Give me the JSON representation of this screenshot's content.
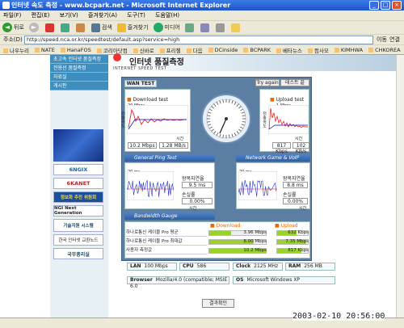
{
  "window": {
    "title": "인터넷 속도 측정 - www.bcpark.net - Microsoft Internet Explorer"
  },
  "menu": [
    "파일(F)",
    "편집(E)",
    "보기(V)",
    "즐겨찾기(A)",
    "도구(T)",
    "도움말(H)"
  ],
  "toolbar": {
    "back": "뒤로",
    "search": "검색",
    "favorites": "즐겨찾기",
    "media": "미디어"
  },
  "address": {
    "label": "주소(D)",
    "url": "http://speed.nca.or.kr/speedtest/default.asp?service=high",
    "go": "이동",
    "links": "연결"
  },
  "links": [
    "나우누리",
    "NATE",
    "HanaFOS",
    "코리아닷컴",
    "신바로",
    "프리첼",
    "다음",
    "DCinside",
    "BCPARK",
    "베타뉴스",
    "컴사모",
    "KIMHWA",
    "CHKOREA"
  ],
  "sidebar": {
    "nav": [
      "초고속 인터넷 품질측정",
      "전용선 품질측정",
      "자료실",
      "게시판"
    ],
    "banners": [
      "6NGIX",
      "6KANET",
      "정보화 추진 위원회",
      "NGI Next Generation",
      "기술지원 시스템",
      "한국 인터넷 교환노드",
      "국무총리실"
    ]
  },
  "header": {
    "title": "인터넷 품질측정",
    "subtitle": "INTERNET SPEED TEST",
    "tab": "WAN TEST",
    "try_again": "Try again",
    "end_test": "테스트 끝"
  },
  "download": {
    "title": "Download test",
    "unit": "Mbps",
    "scale": "20 Mbps",
    "axis": "시간",
    "ylabel": "전송속도",
    "v1": "10.2 Mbps",
    "v2": "1.28 MB/s"
  },
  "upload": {
    "title": "Upload test",
    "unit": "Mbps",
    "scale": "1 Mbps",
    "axis": "시간",
    "ylabel": "전송속도",
    "v1": "817 Kbps",
    "v2": "102 KB/s"
  },
  "ping": {
    "title": "General Ping Test",
    "scale": "20 ms",
    "axis": "시간",
    "ylabel": "지연시간",
    "rtt_label": "왕복지연율",
    "rtt": "9.5 ms",
    "loss_label": "손실률",
    "loss": "0.00%"
  },
  "voip": {
    "title": "Network Game & VoIP Test",
    "scale": "20 ms",
    "axis": "시간",
    "ylabel": "지연시간",
    "rtt_label": "왕복지연율",
    "rtt": "8.8 ms",
    "loss_label": "손실률",
    "loss": "0.00%"
  },
  "gauge": {
    "title": "Bandwidth Gauge",
    "download": "Download",
    "upload": "Upload",
    "rows": [
      {
        "name": "하나로통신 케이블 Pro 평균",
        "down": "3.96 Mbps",
        "up": "632 Kbps",
        "down_frac": 0.39,
        "up_frac": 0.62
      },
      {
        "name": "하나로통신 케이블 Pro 최대값",
        "down": "8.00 Mbps",
        "up": "7.35 Mbps",
        "down_frac": 0.78,
        "up_frac": 0.96
      },
      {
        "name": "사용자 측정값",
        "down": "10.2 Mbps",
        "up": "817 Kbps",
        "down_frac": 1.0,
        "up_frac": 0.8
      }
    ]
  },
  "sysinfo": {
    "lan_l": "LAN",
    "lan": "100 Mbps",
    "cpu_l": "CPU",
    "cpu": "586",
    "clock_l": "Clock",
    "clock": "2125 MHz",
    "ram_l": "RAM",
    "ram": "256 MB",
    "browser_l": "Browser",
    "browser": "Mozilla/4.0 (compatible; MSIE 6.0",
    "os_l": "OS",
    "os": "Microsoft Windows XP"
  },
  "result_button": "결과확인",
  "timestamp": "2003-02-10 20:56:00",
  "colors": {
    "download": "#d11",
    "upload": "#d11",
    "ping": "#2233cc",
    "panel": "#5d7ea3"
  }
}
